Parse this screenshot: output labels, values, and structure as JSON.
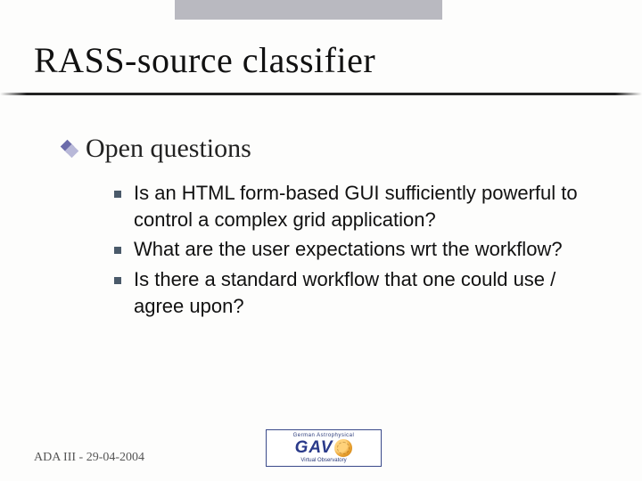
{
  "title": "RASS-source classifier",
  "section_heading": "Open questions",
  "bullets": [
    "Is an HTML form-based GUI sufficiently powerful to control a complex grid application?",
    "What are the user expectations wrt the workflow?",
    "Is there a standard workflow that one could use / agree upon?"
  ],
  "footer": "ADA III - 29-04-2004",
  "logo": {
    "top": "German Astrophysical",
    "text": "GAV",
    "bottom": "Virtual Observatory"
  }
}
